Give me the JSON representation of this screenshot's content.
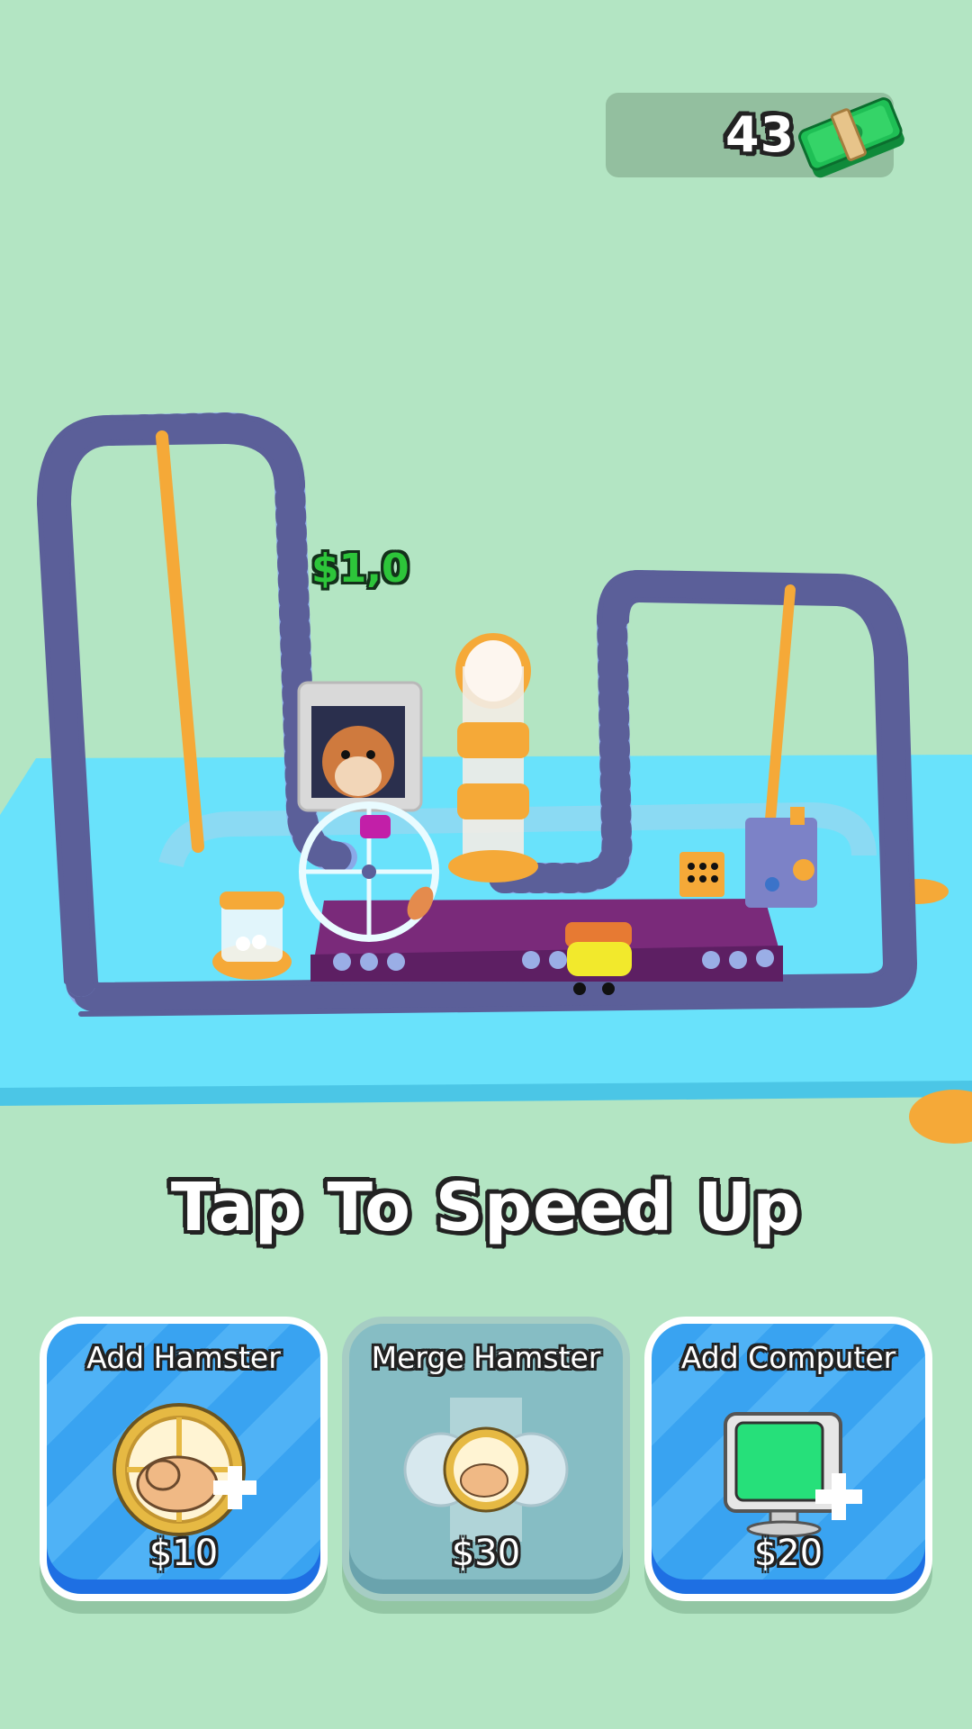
{
  "hud": {
    "money": "43",
    "money_icon": "cash-stack-icon"
  },
  "scene": {
    "floating_income": "$1,0"
  },
  "hint": "Tap To Speed Up",
  "actions": [
    {
      "title": "Add Hamster",
      "price": "$10",
      "icon": "hamster-wheel-add-icon",
      "enabled": true
    },
    {
      "title": "Merge Hamster",
      "price": "$30",
      "icon": "hamster-merge-icon",
      "enabled": false
    },
    {
      "title": "Add Computer",
      "price": "$20",
      "icon": "computer-add-icon",
      "enabled": true
    }
  ],
  "colors": {
    "background": "#b3e5c3",
    "table": "#69e2fb",
    "track": "#5b5f99",
    "card_blue": "#39a3f1",
    "card_disabled": "#86bdc4",
    "income_green": "#2dc53a"
  }
}
